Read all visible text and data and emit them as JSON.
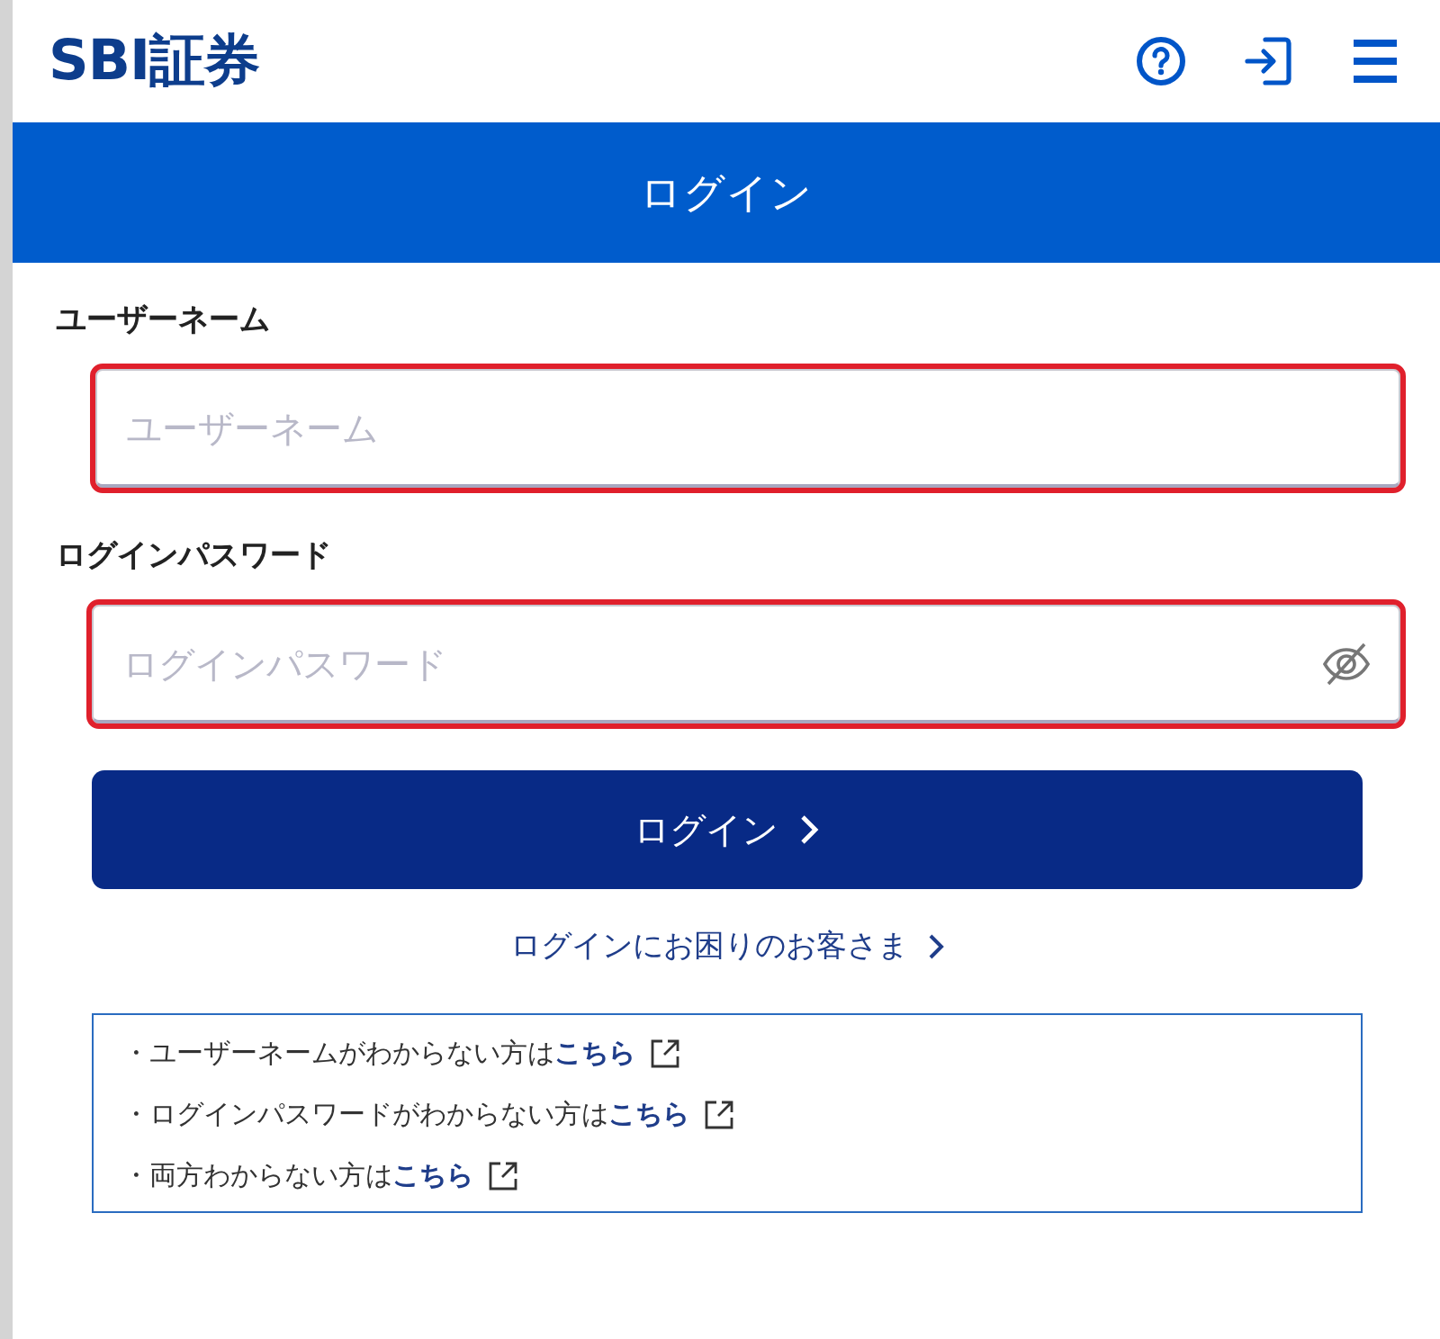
{
  "header": {
    "logo": "SBI証券"
  },
  "title_bar": {
    "title": "ログイン"
  },
  "fields": [
    {
      "kind": "text",
      "label": "ユーザーネーム",
      "placeholder": "ユーザーネーム",
      "highlighted": true
    },
    {
      "kind": "password",
      "label": "ログインパスワード",
      "placeholder": "ログインパスワード",
      "highlighted": true
    }
  ],
  "login_button": {
    "label": "ログイン"
  },
  "help_link": {
    "label": "ログインにお困りのお客さま"
  },
  "help_box": [
    {
      "text": "・ユーザーネームがわからない方は",
      "link": "こちら"
    },
    {
      "text": "・ログインパスワードがわからない方は",
      "link": "こちら"
    },
    {
      "text": "・両方わからない方は",
      "link": "こちら"
    }
  ]
}
